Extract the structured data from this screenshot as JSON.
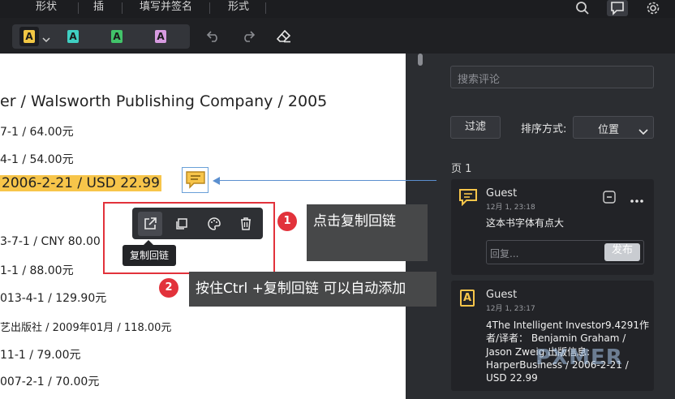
{
  "menu": {
    "items": [
      "形状",
      "插",
      "填写并签名",
      "形式"
    ]
  },
  "document": {
    "lines": [
      "er / Walsworth Publishing Company / 2005",
      "7-1 / 64.00元",
      "4-1 / 54.00元",
      "2006-2-21 / USD 22.99",
      "3-7-1 / CNY 80.00",
      "1-1 / 88.00元",
      "013-4-1 / 129.90元",
      "艺出版社 / 2009年01月 / 118.00元",
      "11-1 / 79.00元",
      "007-2-1 / 70.00元"
    ]
  },
  "popup": {
    "tooltip": "复制回链"
  },
  "annotations": {
    "badge1": "1",
    "callout1": "点击复制回链",
    "badge2": "2",
    "callout2": "按住Ctrl +复制回链  可以自动添加"
  },
  "sidebar": {
    "search_placeholder": "搜索评论",
    "filter_label": "过滤",
    "sort_label": "排序方式:",
    "sort_value": "位置",
    "page_label": "页 1",
    "comments": [
      {
        "author": "Guest",
        "date": "12月 1, 23:18",
        "text": "这本书字体有点大",
        "reply_placeholder": "回复...",
        "send_label": "发布"
      },
      {
        "author": "Guest",
        "date": "12月 1, 23:17",
        "text_lines": [
          "4The Intelligent Investor9.4291作",
          "者/译者： Benjamin Graham /",
          "Jason Zweig 出版信息:",
          "HarperBusiness / 2006-2-21 /",
          "USD 22.99"
        ]
      }
    ]
  },
  "watermark": "PXMER",
  "colors": {
    "highlight_yellow": "#f7c54a",
    "annotation_red": "#e2323b",
    "link_blue": "#5b8fcf"
  }
}
